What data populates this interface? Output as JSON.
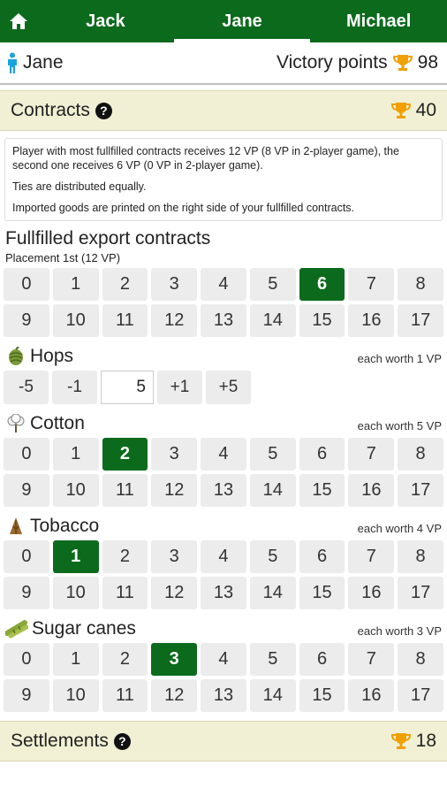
{
  "nav": {
    "tabs": [
      {
        "label": "Jack",
        "active": false
      },
      {
        "label": "Jane",
        "active": true
      },
      {
        "label": "Michael",
        "active": false
      }
    ]
  },
  "player": {
    "name": "Jane",
    "vp_label": "Victory points",
    "vp_value": "98"
  },
  "contracts": {
    "title": "Contracts",
    "points": "40",
    "info": [
      "Player with most fullfilled contracts receives 12 VP (8 VP in 2-player game), the second one receives 6 VP (0 VP in 2-player game).",
      "Ties are distributed equally.",
      "Imported goods are printed on the right side of your fullfilled contracts."
    ],
    "export_title": "Fullfilled export contracts",
    "placement": "Placement 1st (12 VP)",
    "export_numbers": [
      "0",
      "1",
      "2",
      "3",
      "4",
      "5",
      "6",
      "7",
      "8",
      "9",
      "10",
      "11",
      "12",
      "13",
      "14",
      "15",
      "16",
      "17"
    ],
    "export_selected": 6
  },
  "hops": {
    "name": "Hops",
    "worth": "each worth 1 VP",
    "minus5": "-5",
    "minus1": "-1",
    "value": "5",
    "plus1": "+1",
    "plus5": "+5"
  },
  "cotton": {
    "name": "Cotton",
    "worth": "each worth 5 VP",
    "numbers": [
      "0",
      "1",
      "2",
      "3",
      "4",
      "5",
      "6",
      "7",
      "8",
      "9",
      "10",
      "11",
      "12",
      "13",
      "14",
      "15",
      "16",
      "17"
    ],
    "selected": 2
  },
  "tobacco": {
    "name": "Tobacco",
    "worth": "each worth 4 VP",
    "numbers": [
      "0",
      "1",
      "2",
      "3",
      "4",
      "5",
      "6",
      "7",
      "8",
      "9",
      "10",
      "11",
      "12",
      "13",
      "14",
      "15",
      "16",
      "17"
    ],
    "selected": 1
  },
  "sugar": {
    "name": "Sugar canes",
    "worth": "each worth 3 VP",
    "numbers": [
      "0",
      "1",
      "2",
      "3",
      "4",
      "5",
      "6",
      "7",
      "8",
      "9",
      "10",
      "11",
      "12",
      "13",
      "14",
      "15",
      "16",
      "17"
    ],
    "selected": 3
  },
  "settlements": {
    "title": "Settlements",
    "points": "18"
  },
  "colors": {
    "accent": "#0b6a1c",
    "trophy": "#f0a000",
    "person": "#1aa3d9",
    "section_bg": "#f1f0d4"
  }
}
